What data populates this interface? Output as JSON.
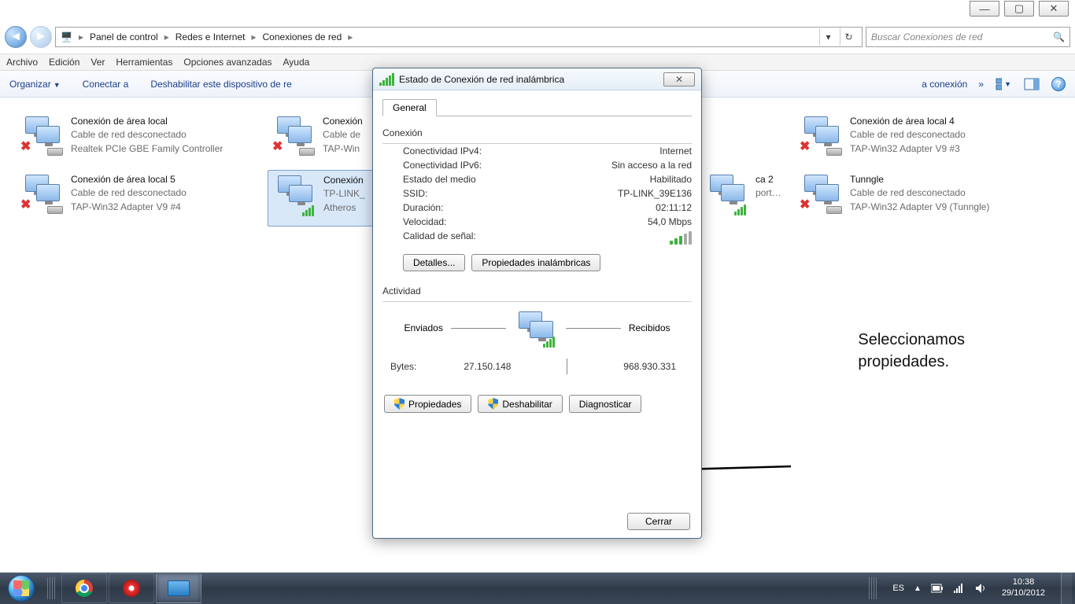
{
  "window_controls": {
    "min": "—",
    "max": "▢",
    "close": "✕"
  },
  "breadcrumbs": [
    "Panel de control",
    "Redes e Internet",
    "Conexiones de red"
  ],
  "address": {
    "dropdown": "▾",
    "refresh": "↻"
  },
  "search_placeholder": "Buscar Conexiones de red",
  "menu": [
    "Archivo",
    "Edición",
    "Ver",
    "Herramientas",
    "Opciones avanzadas",
    "Ayuda"
  ],
  "cmdbar": {
    "organize": "Organizar",
    "connect": "Conectar a",
    "disable": "Deshabilitar este dispositivo de re",
    "diagnose_tail": "a conexión",
    "overflow": "»"
  },
  "connections": [
    {
      "title": "Conexión de área local",
      "sub1": "Cable de red desconectado",
      "sub2": "Realtek PCIe GBE Family Controller",
      "disabled": true
    },
    {
      "title": "Conexión",
      "sub1": "Cable de",
      "sub2": "TAP-Win",
      "disabled": true,
      "clipped": true
    },
    {
      "title": "Conexión de área local 4",
      "sub1": "Cable de red desconectado",
      "sub2": "TAP-Win32 Adapter V9 #3",
      "disabled": true,
      "col4": true
    },
    {
      "title": "Conexión de área local 5",
      "sub1": "Cable de red desconectado",
      "sub2": "TAP-Win32 Adapter V9 #4",
      "disabled": true
    },
    {
      "title": "Conexión",
      "sub1": "TP-LINK_",
      "sub2": "Atheros ",
      "wifi": true,
      "selected": true,
      "clipped": true
    },
    {
      "title": "ca 2",
      "sub1": "",
      "sub2": "port A...",
      "wifi": true,
      "col3": true
    },
    {
      "title": "Tunngle",
      "sub1": "Cable de red desconectado",
      "sub2": "TAP-Win32 Adapter V9 (Tunngle)",
      "disabled": true,
      "col4": true
    }
  ],
  "dialog": {
    "title": "Estado de Conexión de red inalámbrica",
    "tab": "General",
    "group_conn": "Conexión",
    "rows": [
      {
        "k": "Conectividad IPv4:",
        "v": "Internet"
      },
      {
        "k": "Conectividad IPv6:",
        "v": "Sin acceso a la red"
      },
      {
        "k": "Estado del medio",
        "v": "Habilitado"
      },
      {
        "k": "SSID:",
        "v": "TP-LINK_39E136"
      },
      {
        "k": "Duración:",
        "v": "02:11:12"
      },
      {
        "k": "Velocidad:",
        "v": "54,0 Mbps"
      }
    ],
    "signal_label": "Calidad de señal:",
    "details": "Detalles...",
    "wprops": "Propiedades inalámbricas",
    "group_act": "Actividad",
    "sent": "Enviados",
    "recv": "Recibidos",
    "bytes_label": "Bytes:",
    "bytes_sent": "27.150.148",
    "bytes_recv": "968.930.331",
    "props": "Propiedades",
    "disable": "Deshabilitar",
    "diag": "Diagnosticar",
    "close": "Cerrar"
  },
  "annotation": {
    "l1": "Seleccionamos",
    "l2": "propiedades."
  },
  "taskbar": {
    "lang": "ES",
    "time": "10:38",
    "date": "29/10/2012"
  }
}
